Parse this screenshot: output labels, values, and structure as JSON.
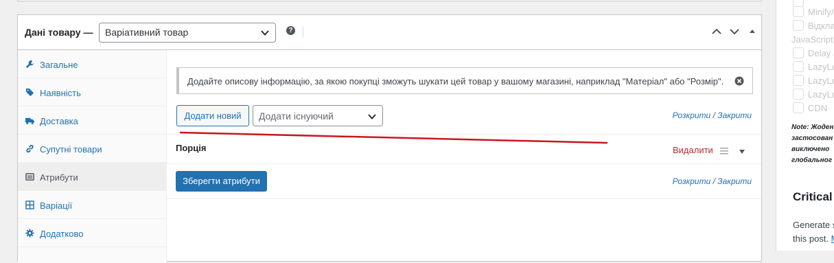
{
  "panel": {
    "title": "Дані товару —",
    "product_type": "Варіативний товар",
    "help_glyph": "?"
  },
  "tabs": [
    {
      "label": "Загальне",
      "icon": "wrench-icon"
    },
    {
      "label": "Наявність",
      "icon": "tag-icon"
    },
    {
      "label": "Доставка",
      "icon": "truck-icon"
    },
    {
      "label": "Супутні товари",
      "icon": "link-icon"
    },
    {
      "label": "Атрибути",
      "icon": "list-icon",
      "active": true
    },
    {
      "label": "Варіації",
      "icon": "grid-icon"
    },
    {
      "label": "Додатково",
      "icon": "gear-icon"
    }
  ],
  "notice": {
    "text": "Додайте описову інформацію, за якою покупці зможуть шукати цей товар у вашому магазині, наприклад \"Матеріал\" або \"Розмір\"."
  },
  "toolbar": {
    "add_new": "Додати новий",
    "add_existing_placeholder": "Додати існуючий",
    "expand": "Розкрити",
    "slash": "/",
    "collapse": "Закрити"
  },
  "attribute": {
    "name": "Порція",
    "remove": "Видалити"
  },
  "save_button": "Зберегти атрибути",
  "sidebar": {
    "options_top": [
      "Minify/",
      "Відкла"
    ],
    "js_label": "JavaScript",
    "options_js": [
      "Delay J",
      "LazyLo",
      "LazyLo",
      "LazyLo",
      "CDN"
    ],
    "note_lines": [
      "Note: Жоден",
      "застосован",
      "виключено",
      "глобальног"
    ],
    "critical_title": "Critical I",
    "generate_line1": "Generate s",
    "generate_line2_prefix": "this post.",
    "generate_link": "M"
  },
  "colors": {
    "accent": "#2271b1",
    "danger": "#b32d2e",
    "annotation_line": "#c8161d"
  }
}
